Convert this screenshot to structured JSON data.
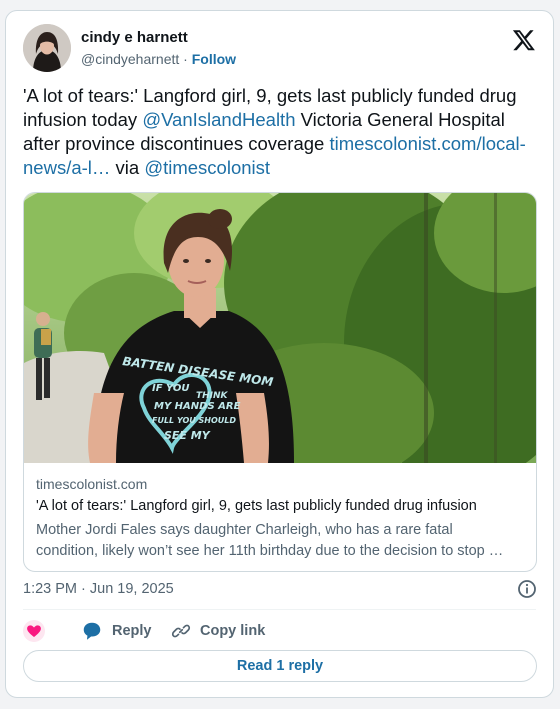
{
  "author": {
    "name": "cindy e harnett",
    "handle": "@cindyeharnett",
    "separator": "·",
    "follow_label": "Follow"
  },
  "tweet": {
    "text_1": "'A lot of tears:' Langford girl, 9, gets last publicly funded drug infusion today ",
    "mention_1": "@VanIslandHealth",
    "text_2": " Victoria General Hospital after province discontinues coverage ",
    "url": "timescolonist.com/local-news/a-l…",
    "text_3": " via ",
    "mention_2": "@timescolonist"
  },
  "link_card": {
    "domain": "timescolonist.com",
    "title": "'A lot of tears:' Langford girl, 9, gets last publicly funded drug infusion",
    "description_line1": "Mother Jordi Fales says daughter Charleigh, who has a rare fatal",
    "description_line2": "condition, likely won’t see her 11th birthday due to the decision to stop …",
    "shirt_line1": "BATTEN DISEASE MOM",
    "shirt_line2": "IF YOU",
    "shirt_line3": "THINK",
    "shirt_line4": "MY HANDS ARE",
    "shirt_line5": "FULL YOU SHOULD",
    "shirt_line6": "SEE MY"
  },
  "meta": {
    "timestamp": "1:23 PM · Jun 19, 2025"
  },
  "actions": {
    "reply_label": "Reply",
    "copy_link_label": "Copy link"
  },
  "read_replies_label": "Read 1 reply",
  "colors": {
    "link": "#1d6fa5",
    "text": "#0f1419",
    "secondary": "#536471",
    "heart": "#f91880",
    "border": "#cfd9de"
  }
}
